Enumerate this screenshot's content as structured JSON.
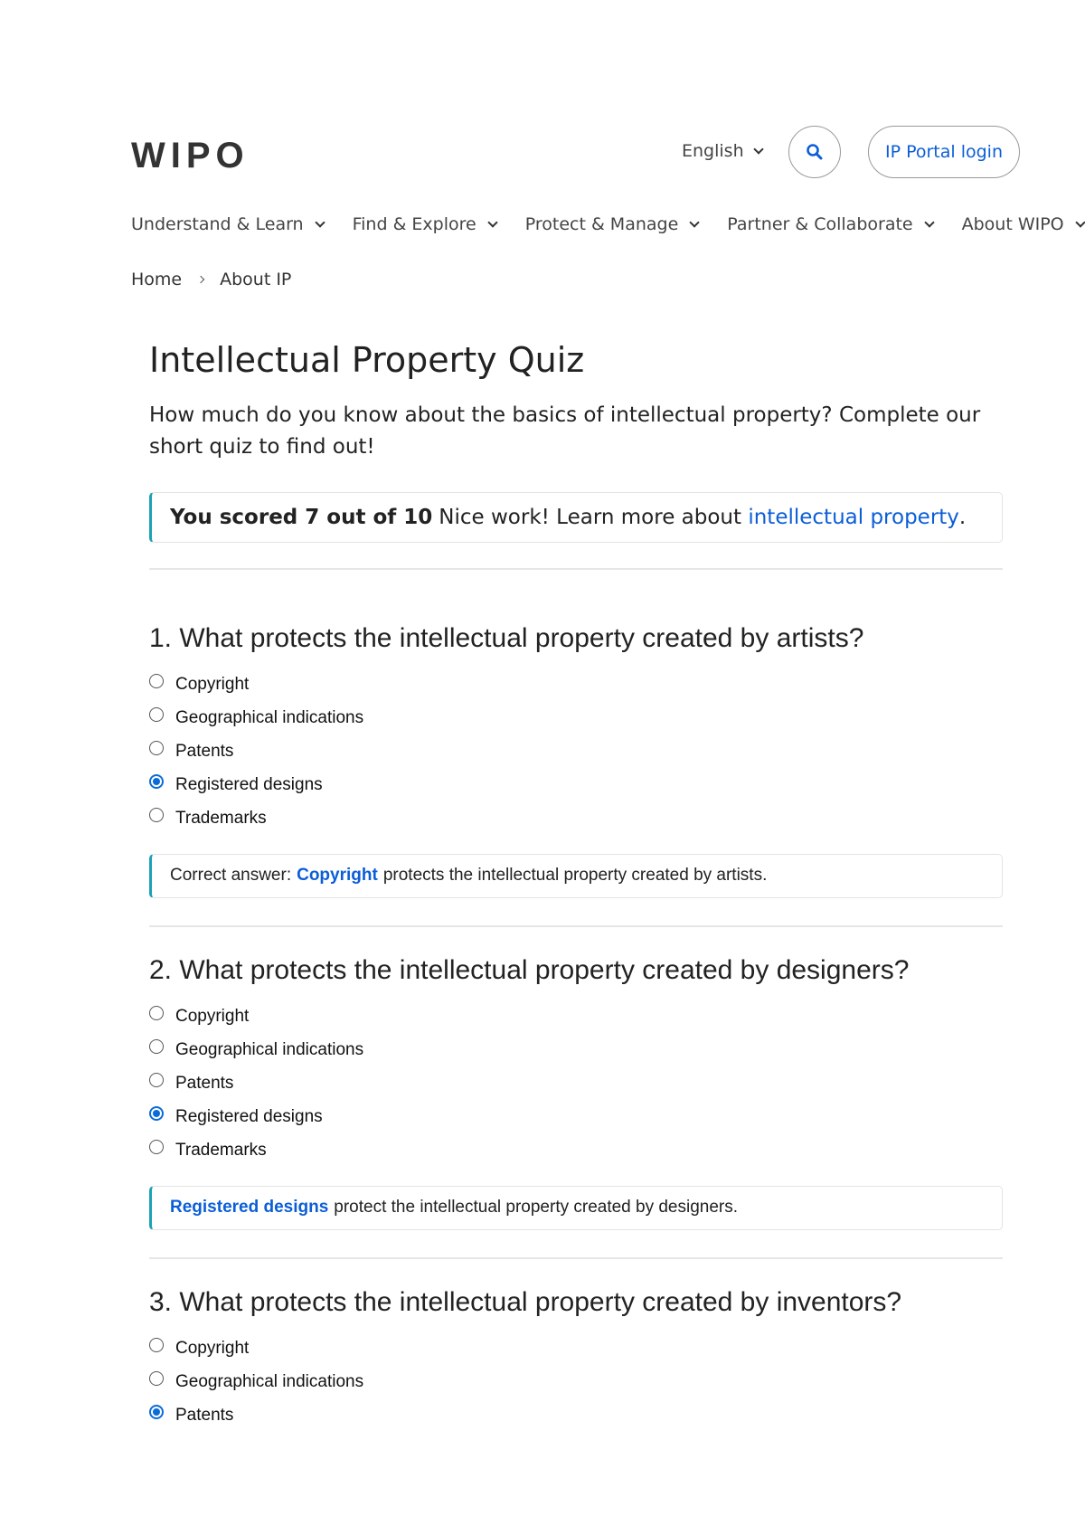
{
  "header": {
    "logo": "WIPO",
    "language": "English",
    "search_icon": "search-icon",
    "login_label": "IP Portal login"
  },
  "nav": {
    "items": [
      {
        "label": "Understand & Learn"
      },
      {
        "label": "Find & Explore"
      },
      {
        "label": "Protect & Manage"
      },
      {
        "label": "Partner & Collaborate"
      },
      {
        "label": "About WIPO"
      }
    ]
  },
  "breadcrumb": {
    "items": [
      {
        "label": "Home"
      },
      {
        "label": "About IP"
      }
    ]
  },
  "page": {
    "title": "Intellectual Property Quiz",
    "intro": "How much do you know about the basics of intellectual property? Complete our short quiz to find out!",
    "score": {
      "bold": "You scored 7 out of 10",
      "text": "Nice work! Learn more about",
      "link": "intellectual property",
      "suffix": "."
    }
  },
  "colors": {
    "accent": "#0b5ed7",
    "radio_checked": "#0b6bd8",
    "callout_border": "#1ba2b5"
  },
  "questions": [
    {
      "title": "1. What protects the intellectual property created by artists?",
      "options": [
        "Copyright",
        "Geographical indications",
        "Patents",
        "Registered designs",
        "Trademarks"
      ],
      "selected": "Registered designs",
      "feedback": {
        "prefix": "Correct answer:",
        "highlight": "Copyright",
        "text": "protects the intellectual property created by artists."
      }
    },
    {
      "title": "2. What protects the intellectual property created by designers?",
      "options": [
        "Copyright",
        "Geographical indications",
        "Patents",
        "Registered designs",
        "Trademarks"
      ],
      "selected": "Registered designs",
      "feedback": {
        "prefix": "",
        "highlight": "Registered designs",
        "text": "protect the intellectual property created by designers."
      }
    },
    {
      "title": "3. What protects the intellectual property created by inventors?",
      "options": [
        "Copyright",
        "Geographical indications",
        "Patents"
      ],
      "selected": "Patents"
    }
  ]
}
